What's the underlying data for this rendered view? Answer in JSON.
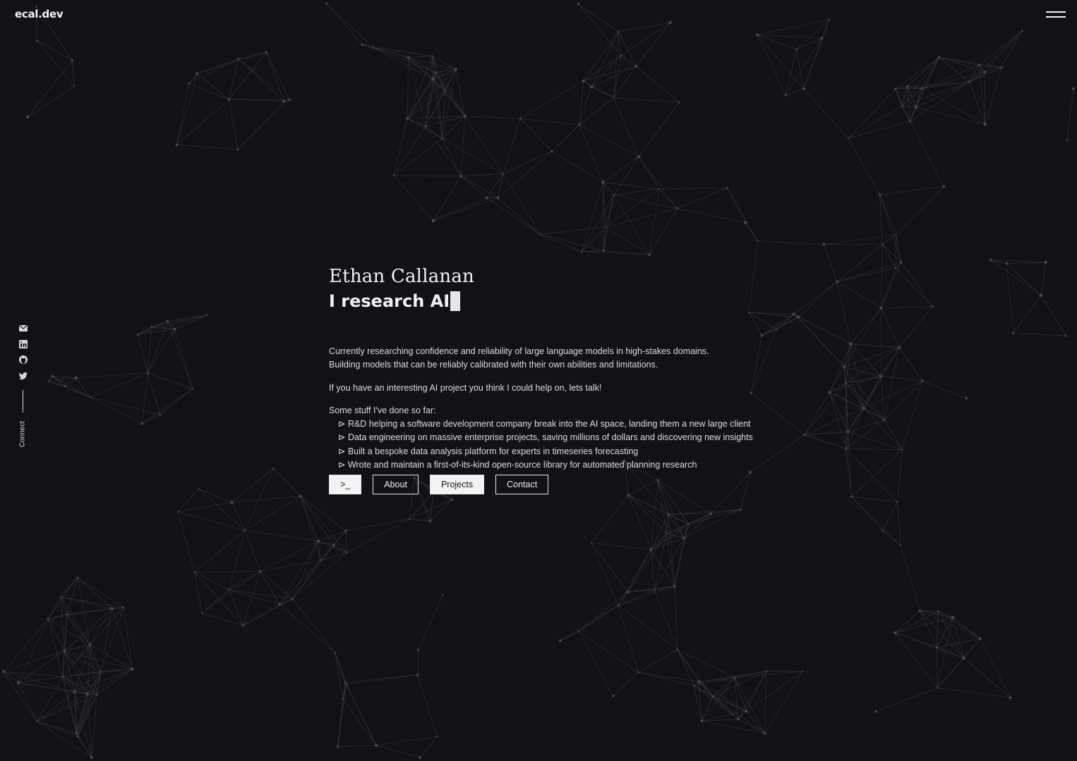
{
  "site": {
    "logo": "ecal.dev",
    "menu_icon": "hamburger-menu-icon"
  },
  "social": {
    "icons": [
      "email-icon",
      "linkedin-icon",
      "github-icon",
      "twitter-icon"
    ],
    "connect_label": "Connect"
  },
  "hero": {
    "name": "Ethan Callanan",
    "tagline": "I research AI"
  },
  "intro": {
    "p1_line1": "Currently researching confidence and reliability of large language models in high-stakes domains.",
    "p1_line2": "Building models that can be reliably calibrated with their own abilities and limitations.",
    "p2": "If you have an interesting AI project you think I could help on, lets talk!",
    "list_heading": "Some stuff I've done so far:",
    "items": [
      "⊳ R&D helping a software development company break into the AI space, landing them a new large client",
      "⊳ Data engineering on massive enterprise projects, saving millions of dollars and discovering new insights",
      "⊳ Built a bespoke data analysis platform for experts in timeseries forecasting",
      "⊳ Wrote and maintain a first-of-its-kind open-source library for automated planning research"
    ]
  },
  "buttons": {
    "terminal": ">_",
    "about": "About",
    "projects": "Projects",
    "contact": "Contact"
  },
  "colors": {
    "background": "#121117",
    "text": "#e8e8ec",
    "network_lines": "#3a3a42"
  }
}
